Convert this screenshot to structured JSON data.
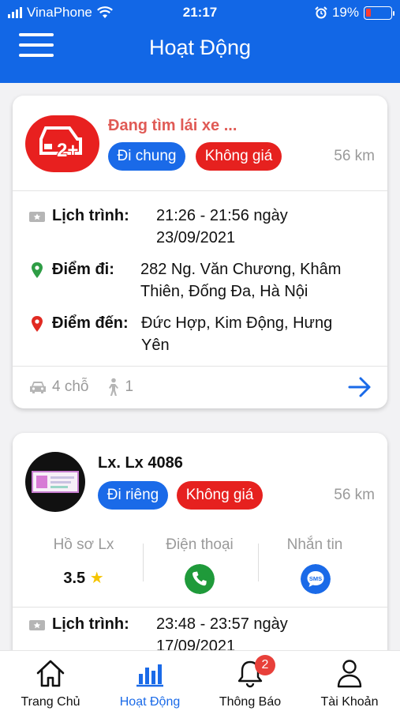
{
  "status_bar": {
    "carrier": "VinaPhone",
    "time": "21:17",
    "battery": "19%",
    "battery_level": 0.19
  },
  "header": {
    "title": "Hoạt Động"
  },
  "trips": [
    {
      "status": "Đang tìm lái xe ...",
      "badge_icon": "car-2plus-icon",
      "tags": [
        "Đi chung",
        "Không giá"
      ],
      "distance": "56 km",
      "schedule_label": "Lịch trình:",
      "schedule_line1": "21:26 - 21:56 ngày",
      "schedule_line2": "23/09/2021",
      "pickup_label": "Điểm đi:",
      "pickup_line1": "282 Ng. Văn Chương, Khâm",
      "pickup_line2": "Thiên, Đống Đa, Hà Nội",
      "dropoff_label": "Điểm đến:",
      "dropoff_line1": "Đức Hợp, Kim Động, Hưng",
      "dropoff_line2": "Yên",
      "seats": "4 chỗ",
      "passengers": "1"
    },
    {
      "driver": "Lx. Lx 4086",
      "tags": [
        "Đi riêng",
        "Không giá"
      ],
      "distance": "56 km",
      "profile_label": "Hồ sơ Lx",
      "rating": "3.5",
      "phone_label": "Điện thoại",
      "message_label": "Nhắn tin",
      "sms_text": "SMS",
      "schedule_label": "Lịch trình:",
      "schedule_line1": "23:48 - 23:57 ngày",
      "schedule_line2": "17/09/2021"
    }
  ],
  "tabs": [
    {
      "label": "Trang Chủ",
      "icon": "home-icon"
    },
    {
      "label": "Hoạt Động",
      "icon": "bar-chart-icon",
      "active": true
    },
    {
      "label": "Thông Báo",
      "icon": "bell-icon",
      "badge": "2"
    },
    {
      "label": "Tài Khoản",
      "icon": "user-icon"
    }
  ],
  "colors": {
    "primary": "#1267e6",
    "danger": "#e6211f",
    "status_text": "#e05a55",
    "phone_green": "#1f9a3a",
    "muted": "#9a9a9a"
  }
}
